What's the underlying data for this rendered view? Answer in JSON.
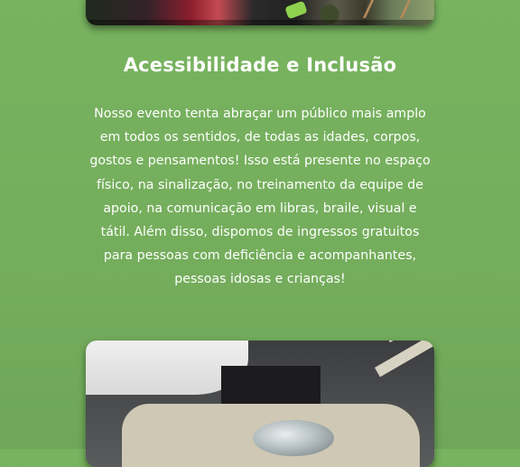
{
  "section": {
    "title": "Acessibilidade e Inclusão",
    "paragraph": "Nosso evento tenta abraçar um público mais amplo em todos os sentidos, de todas as idades, corpos, gostos e pensamentos! Isso está presente no espaço físico, na sinalização, no treinamento da equipe de apoio, na comunicação em libras, braile, visual e tátil. Além disso, dispomos de ingressos gratuitos para pessoas com deficiência e acompanhantes, pessoas idosas e crianças!"
  },
  "colors": {
    "background": "#78b35f",
    "text": "#ffffff"
  }
}
